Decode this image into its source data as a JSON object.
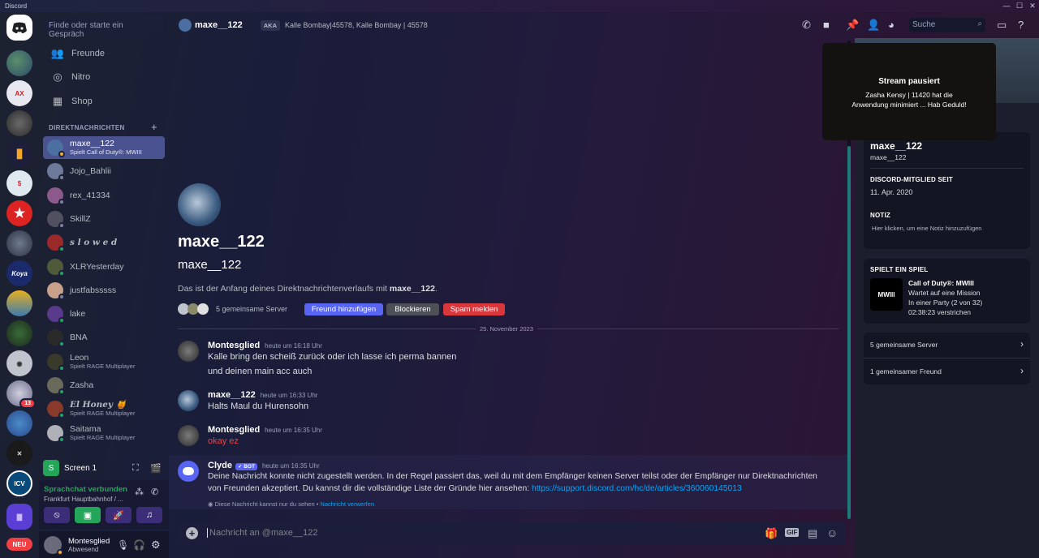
{
  "app": {
    "title": "Discord"
  },
  "rail": {
    "new_badge": "NEU",
    "badge_13": "13"
  },
  "sidebar": {
    "search_placeholder": "Finde oder starte ein Gespräch",
    "nav": [
      {
        "label": "Freunde",
        "icon": "friends-icon"
      },
      {
        "label": "Nitro",
        "icon": "nitro-icon"
      },
      {
        "label": "Shop",
        "icon": "shop-icon"
      }
    ],
    "dm_header": "DIREKTNACHRICHTEN",
    "dms": [
      {
        "name": "maxe__122",
        "sub": "Spielt Call of Duty®: MWIII",
        "color": "#4a6fa0"
      },
      {
        "name": "Jojo_Bahlii",
        "sub": "",
        "color": "#6d7a9a"
      },
      {
        "name": "rex_41334",
        "sub": "",
        "color": "#8b5a8a"
      },
      {
        "name": "SkillZ",
        "sub": "",
        "color": "#505060"
      },
      {
        "name": "s l o w e d",
        "sub": "",
        "color": "#9a2a2a"
      },
      {
        "name": "XLRYesterday",
        "sub": "",
        "color": "#4e5a3a"
      },
      {
        "name": "justfabsssss",
        "sub": "",
        "color": "#c9a08a"
      },
      {
        "name": "lake",
        "sub": "",
        "color": "#5a3a8a"
      },
      {
        "name": "BNA",
        "sub": "",
        "color": "#2a2a2a"
      },
      {
        "name": "Leon",
        "sub": "Spielt RAGE Multiplayer",
        "color": "#3a3a2a"
      },
      {
        "name": "Zasha",
        "sub": "",
        "color": "#6a6a5a"
      },
      {
        "name": "El Honey 🍯",
        "sub": "Spielt RAGE Multiplayer",
        "color": "#8a3a2a"
      },
      {
        "name": "Saitama",
        "sub": "Spielt RAGE Multiplayer",
        "color": "#b0b0b8"
      }
    ]
  },
  "panel": {
    "screen_label": "Screen 1",
    "voice_status": "Sprachchat verbunden",
    "voice_channel": "Frankfurt Hauptbahnhof / ...",
    "user_name": "Montesglied",
    "user_status": "Abwesend"
  },
  "header": {
    "name": "maxe__122",
    "aka_label": "AKA",
    "aka": "Kalle Bombay|45578, Kalle Bombay | 45578",
    "search": "Suche"
  },
  "intro": {
    "display_name": "maxe__122",
    "username": "maxe__122",
    "text_prefix": "Das ist der Anfang deines Direktnachrichtenverlaufs mit ",
    "text_name": "maxe__122",
    "text_suffix": ".",
    "mutual": "5 gemeinsame Server",
    "btn_add": "Freund hinzufügen",
    "btn_block": "Blockieren",
    "btn_spam": "Spam melden"
  },
  "divider_date": "25. November 2023",
  "messages": [
    {
      "author": "Montesglied",
      "time": "heute um 16:18 Uhr",
      "lines": [
        "Kalle bring den scheiß zurück oder ich lasse ich perma bannen",
        "und deinen main acc auch"
      ]
    },
    {
      "author": "maxe__122",
      "time": "heute um 16:33 Uhr",
      "lines": [
        "Halts Maul du Hurensohn"
      ]
    },
    {
      "author": "Montesglied",
      "time": "heute um 16:35 Uhr",
      "lines": [
        "okay ez"
      ]
    },
    {
      "author": "Clyde",
      "bot": "✓ BOT",
      "time": "heute um 16:35 Uhr",
      "lines": [
        "Deine Nachricht konnte nicht zugestellt werden. In der Regel passiert das, weil du mit dem Empfänger keinen Server teilst oder der Empfänger nur Direktnachrichten",
        "von Freunden akzeptiert. Du kannst dir die vollständige Liste der Gründe hier ansehen: "
      ],
      "link": "https://support.discord.com/hc/de/articles/360060145013",
      "note": "Diese Nachricht kannst nur du sehen • ",
      "note_link": "Nachricht verwerfen"
    }
  ],
  "composer": {
    "placeholder": "Nachricht an @maxe__122",
    "gif": "GIF"
  },
  "profile": {
    "overlay_title": "Stream pausiert",
    "overlay_text": "Zasha Kensy | 11420 hat die Anwendung minimiert ... Hab Geduld!",
    "display_name": "maxe__122",
    "username": "maxe__122",
    "member_since_label": "DISCORD-MITGLIED SEIT",
    "member_since": "11. Apr. 2020",
    "note_label": "NOTIZ",
    "note_placeholder": "Hier klicken, um eine Notiz hinzuzufügen",
    "playing_label": "SPIELT EIN SPIEL",
    "game": "Call of Duty®: MWIII",
    "game_logo": "MWIII",
    "game_l1": "Wartet auf eine Mission",
    "game_l2": "In einer Party (2 von 32)",
    "game_l3": "02:38:23 verstrichen",
    "mutual_servers": "5 gemeinsame Server",
    "mutual_friends": "1 gemeinsamer Freund"
  }
}
